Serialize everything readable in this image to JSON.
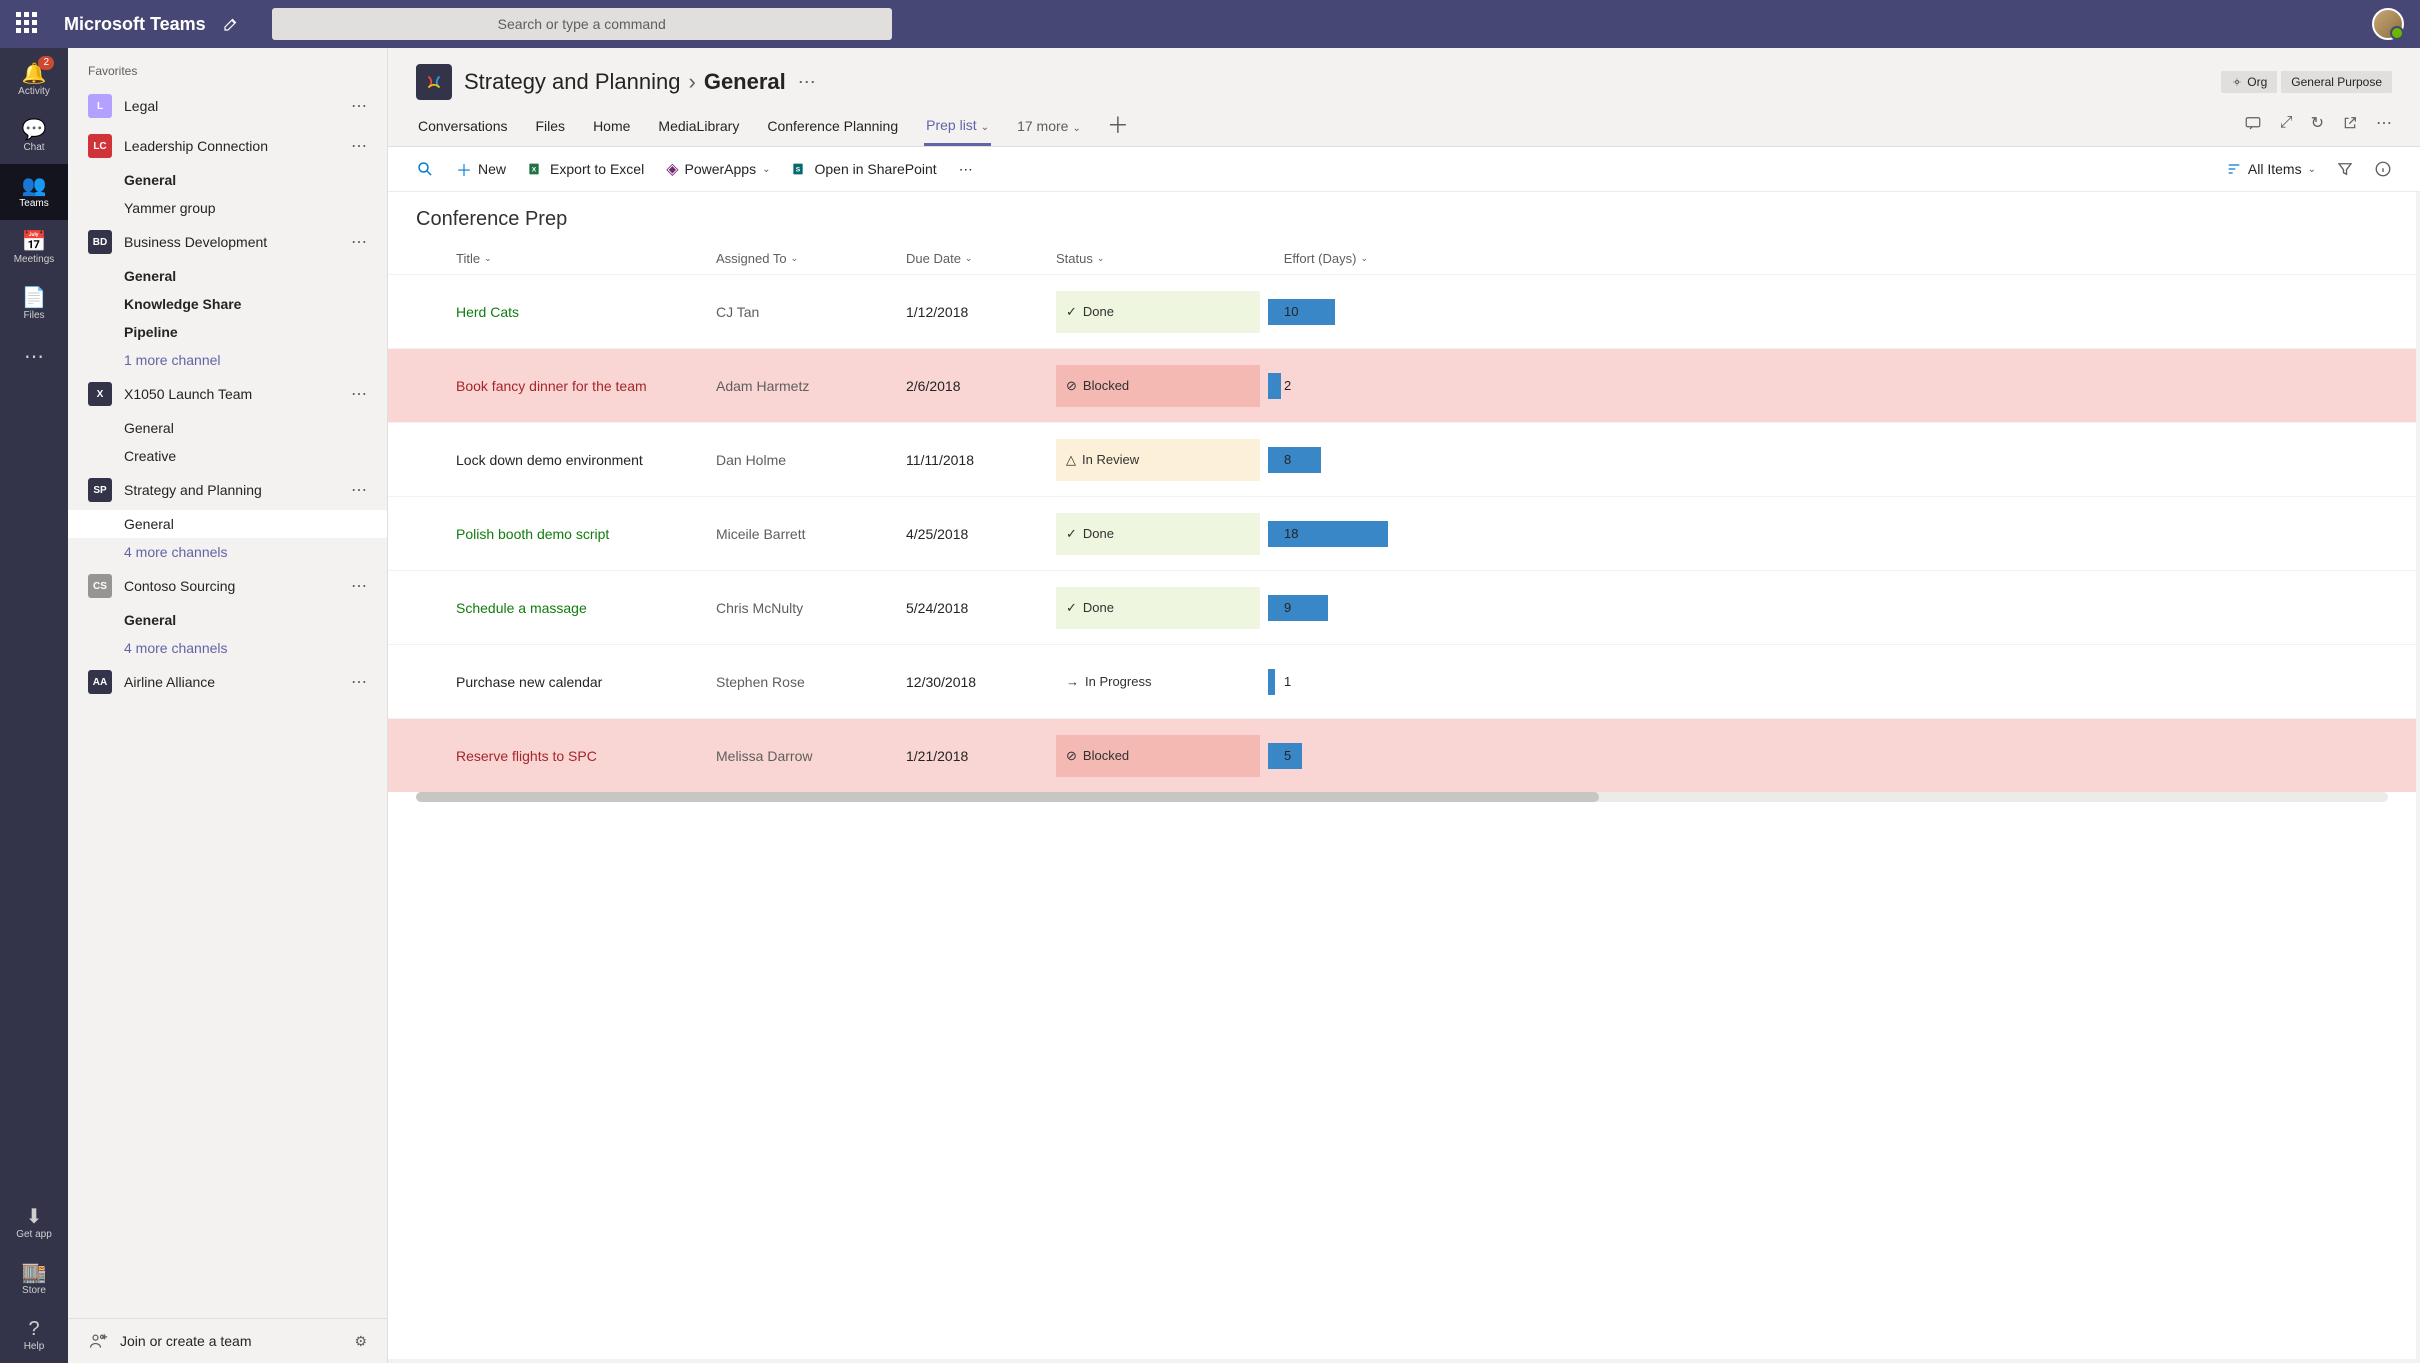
{
  "app_title": "Microsoft Teams",
  "search_placeholder": "Search or type a command",
  "rail": [
    {
      "label": "Activity",
      "icon": "🔔",
      "badge": "2"
    },
    {
      "label": "Chat",
      "icon": "💬"
    },
    {
      "label": "Teams",
      "icon": "👥",
      "active": true
    },
    {
      "label": "Meetings",
      "icon": "📅"
    },
    {
      "label": "Files",
      "icon": "📄"
    }
  ],
  "rail_bottom": [
    {
      "label": "Get app",
      "icon": "⬇"
    },
    {
      "label": "Store",
      "icon": "🏬"
    },
    {
      "label": "Help",
      "icon": "?"
    }
  ],
  "favorites_label": "Favorites",
  "teams": [
    {
      "name": "Legal",
      "color": "#b4a0ff",
      "abbr": "L",
      "channels": []
    },
    {
      "name": "Leadership Connection",
      "color": "#d13438",
      "abbr": "LC",
      "channels": [
        {
          "name": "General",
          "bold": true
        },
        {
          "name": "Yammer group"
        }
      ]
    },
    {
      "name": "Business Development",
      "color": "#33344a",
      "abbr": "BD",
      "icon": "shield",
      "channels": [
        {
          "name": "General",
          "bold": true
        },
        {
          "name": "Knowledge Share",
          "bold": true
        },
        {
          "name": "Pipeline",
          "bold": true
        },
        {
          "name": "1 more channel",
          "link": true
        }
      ]
    },
    {
      "name": "X1050 Launch Team",
      "color": "#33344a",
      "abbr": "X",
      "icon": "drone",
      "channels": [
        {
          "name": "General"
        },
        {
          "name": "Creative"
        }
      ]
    },
    {
      "name": "Strategy and Planning",
      "color": "#33344a",
      "abbr": "SP",
      "icon": "loop",
      "channels": [
        {
          "name": "General",
          "selected": true
        },
        {
          "name": "4 more channels",
          "link": true
        }
      ]
    },
    {
      "name": "Contoso Sourcing",
      "color": "#979593",
      "abbr": "CS",
      "channels": [
        {
          "name": "General",
          "bold": true
        },
        {
          "name": "4 more channels",
          "link": true
        }
      ]
    },
    {
      "name": "Airline Alliance",
      "color": "#33344a",
      "abbr": "AA",
      "icon": "plane",
      "channels": []
    }
  ],
  "join_create_label": "Join or create a team",
  "breadcrumb": {
    "team": "Strategy and Planning",
    "channel": "General"
  },
  "header_right": {
    "org": "Org",
    "purpose": "General Purpose"
  },
  "tabs": [
    {
      "label": "Conversations"
    },
    {
      "label": "Files"
    },
    {
      "label": "Home"
    },
    {
      "label": "MediaLibrary"
    },
    {
      "label": "Conference Planning"
    },
    {
      "label": "Prep list",
      "active": true,
      "chev": true
    },
    {
      "label": "17 more",
      "chev": true,
      "more": true
    }
  ],
  "cmdbar": {
    "new": "New",
    "export": "Export to Excel",
    "powerapps": "PowerApps",
    "sharepoint": "Open in SharePoint",
    "allitems": "All Items"
  },
  "list_title": "Conference Prep",
  "columns": [
    "Title",
    "Assigned To",
    "Due Date",
    "Status",
    "Effort (Days)"
  ],
  "rows": [
    {
      "title": "Herd Cats",
      "assigned": "CJ Tan",
      "due": "1/12/2018",
      "status": "Done",
      "effort": 10
    },
    {
      "title": "Book fancy dinner for the team",
      "assigned": "Adam Harmetz",
      "due": "2/6/2018",
      "status": "Blocked",
      "effort": 2
    },
    {
      "title": "Lock down demo environment",
      "assigned": "Dan Holme",
      "due": "11/11/2018",
      "status": "In Review",
      "effort": 8
    },
    {
      "title": "Polish booth demo script",
      "assigned": "Miceile Barrett",
      "due": "4/25/2018",
      "status": "Done",
      "effort": 18
    },
    {
      "title": "Schedule a massage",
      "assigned": "Chris McNulty",
      "due": "5/24/2018",
      "status": "Done",
      "effort": 9
    },
    {
      "title": "Purchase new calendar",
      "assigned": "Stephen Rose",
      "due": "12/30/2018",
      "status": "In Progress",
      "effort": 1
    },
    {
      "title": "Reserve flights to SPC",
      "assigned": "Melissa Darrow",
      "due": "1/21/2018",
      "status": "Blocked",
      "effort": 5
    }
  ],
  "effort_max": 18
}
